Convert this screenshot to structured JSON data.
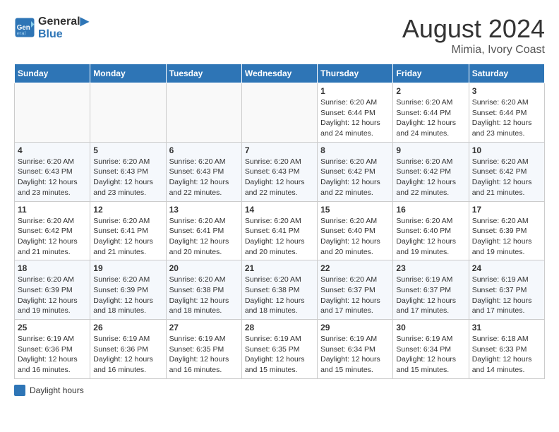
{
  "header": {
    "logo_line1": "General",
    "logo_line2": "Blue",
    "month_year": "August 2024",
    "location": "Mimia, Ivory Coast"
  },
  "days_of_week": [
    "Sunday",
    "Monday",
    "Tuesday",
    "Wednesday",
    "Thursday",
    "Friday",
    "Saturday"
  ],
  "weeks": [
    [
      {
        "day": "",
        "info": ""
      },
      {
        "day": "",
        "info": ""
      },
      {
        "day": "",
        "info": ""
      },
      {
        "day": "",
        "info": ""
      },
      {
        "day": "1",
        "info": "Sunrise: 6:20 AM\nSunset: 6:44 PM\nDaylight: 12 hours\nand 24 minutes."
      },
      {
        "day": "2",
        "info": "Sunrise: 6:20 AM\nSunset: 6:44 PM\nDaylight: 12 hours\nand 24 minutes."
      },
      {
        "day": "3",
        "info": "Sunrise: 6:20 AM\nSunset: 6:44 PM\nDaylight: 12 hours\nand 23 minutes."
      }
    ],
    [
      {
        "day": "4",
        "info": "Sunrise: 6:20 AM\nSunset: 6:43 PM\nDaylight: 12 hours\nand 23 minutes."
      },
      {
        "day": "5",
        "info": "Sunrise: 6:20 AM\nSunset: 6:43 PM\nDaylight: 12 hours\nand 23 minutes."
      },
      {
        "day": "6",
        "info": "Sunrise: 6:20 AM\nSunset: 6:43 PM\nDaylight: 12 hours\nand 22 minutes."
      },
      {
        "day": "7",
        "info": "Sunrise: 6:20 AM\nSunset: 6:43 PM\nDaylight: 12 hours\nand 22 minutes."
      },
      {
        "day": "8",
        "info": "Sunrise: 6:20 AM\nSunset: 6:42 PM\nDaylight: 12 hours\nand 22 minutes."
      },
      {
        "day": "9",
        "info": "Sunrise: 6:20 AM\nSunset: 6:42 PM\nDaylight: 12 hours\nand 22 minutes."
      },
      {
        "day": "10",
        "info": "Sunrise: 6:20 AM\nSunset: 6:42 PM\nDaylight: 12 hours\nand 21 minutes."
      }
    ],
    [
      {
        "day": "11",
        "info": "Sunrise: 6:20 AM\nSunset: 6:42 PM\nDaylight: 12 hours\nand 21 minutes."
      },
      {
        "day": "12",
        "info": "Sunrise: 6:20 AM\nSunset: 6:41 PM\nDaylight: 12 hours\nand 21 minutes."
      },
      {
        "day": "13",
        "info": "Sunrise: 6:20 AM\nSunset: 6:41 PM\nDaylight: 12 hours\nand 20 minutes."
      },
      {
        "day": "14",
        "info": "Sunrise: 6:20 AM\nSunset: 6:41 PM\nDaylight: 12 hours\nand 20 minutes."
      },
      {
        "day": "15",
        "info": "Sunrise: 6:20 AM\nSunset: 6:40 PM\nDaylight: 12 hours\nand 20 minutes."
      },
      {
        "day": "16",
        "info": "Sunrise: 6:20 AM\nSunset: 6:40 PM\nDaylight: 12 hours\nand 19 minutes."
      },
      {
        "day": "17",
        "info": "Sunrise: 6:20 AM\nSunset: 6:39 PM\nDaylight: 12 hours\nand 19 minutes."
      }
    ],
    [
      {
        "day": "18",
        "info": "Sunrise: 6:20 AM\nSunset: 6:39 PM\nDaylight: 12 hours\nand 19 minutes."
      },
      {
        "day": "19",
        "info": "Sunrise: 6:20 AM\nSunset: 6:39 PM\nDaylight: 12 hours\nand 18 minutes."
      },
      {
        "day": "20",
        "info": "Sunrise: 6:20 AM\nSunset: 6:38 PM\nDaylight: 12 hours\nand 18 minutes."
      },
      {
        "day": "21",
        "info": "Sunrise: 6:20 AM\nSunset: 6:38 PM\nDaylight: 12 hours\nand 18 minutes."
      },
      {
        "day": "22",
        "info": "Sunrise: 6:20 AM\nSunset: 6:37 PM\nDaylight: 12 hours\nand 17 minutes."
      },
      {
        "day": "23",
        "info": "Sunrise: 6:19 AM\nSunset: 6:37 PM\nDaylight: 12 hours\nand 17 minutes."
      },
      {
        "day": "24",
        "info": "Sunrise: 6:19 AM\nSunset: 6:37 PM\nDaylight: 12 hours\nand 17 minutes."
      }
    ],
    [
      {
        "day": "25",
        "info": "Sunrise: 6:19 AM\nSunset: 6:36 PM\nDaylight: 12 hours\nand 16 minutes."
      },
      {
        "day": "26",
        "info": "Sunrise: 6:19 AM\nSunset: 6:36 PM\nDaylight: 12 hours\nand 16 minutes."
      },
      {
        "day": "27",
        "info": "Sunrise: 6:19 AM\nSunset: 6:35 PM\nDaylight: 12 hours\nand 16 minutes."
      },
      {
        "day": "28",
        "info": "Sunrise: 6:19 AM\nSunset: 6:35 PM\nDaylight: 12 hours\nand 15 minutes."
      },
      {
        "day": "29",
        "info": "Sunrise: 6:19 AM\nSunset: 6:34 PM\nDaylight: 12 hours\nand 15 minutes."
      },
      {
        "day": "30",
        "info": "Sunrise: 6:19 AM\nSunset: 6:34 PM\nDaylight: 12 hours\nand 15 minutes."
      },
      {
        "day": "31",
        "info": "Sunrise: 6:18 AM\nSunset: 6:33 PM\nDaylight: 12 hours\nand 14 minutes."
      }
    ]
  ],
  "legend": {
    "label": "Daylight hours"
  }
}
